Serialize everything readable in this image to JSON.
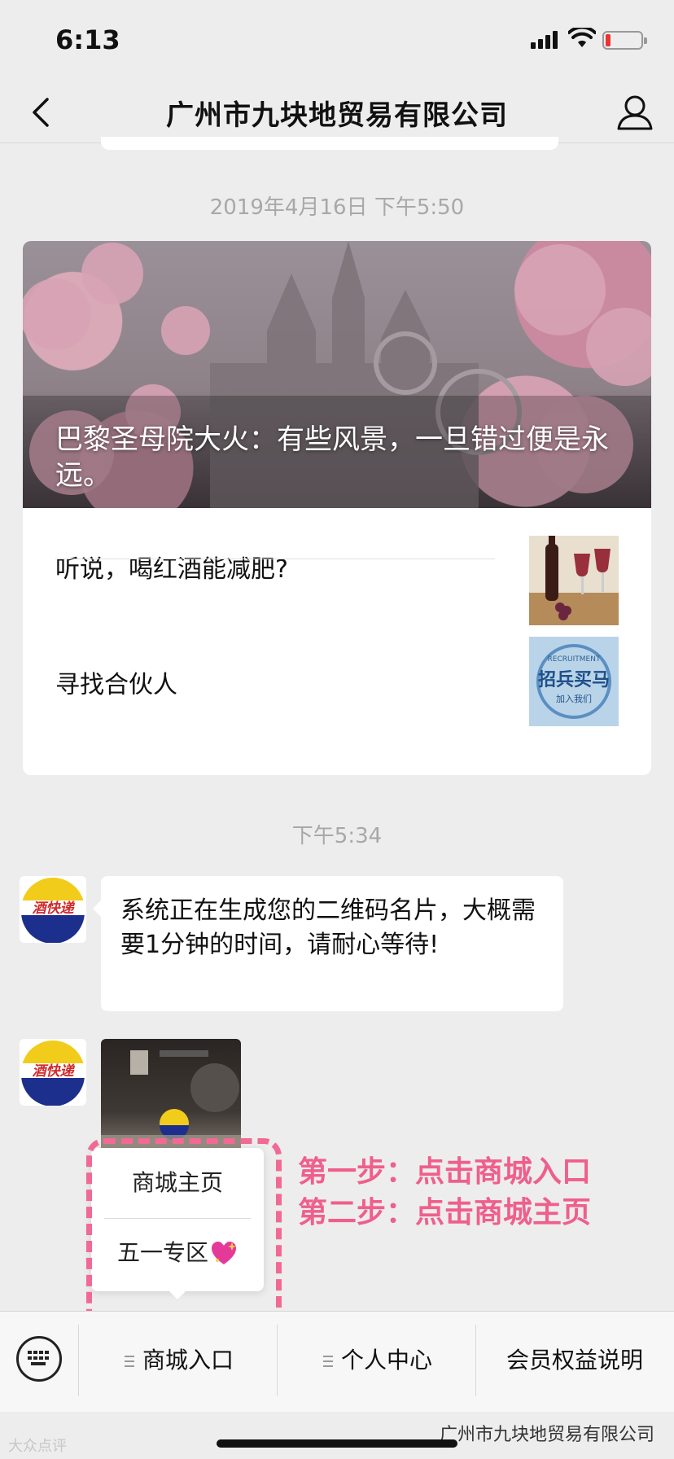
{
  "status_bar": {
    "time": "6:13",
    "battery_level": 0.15
  },
  "nav": {
    "title": "广州市九块地贸易有限公司",
    "back_icon": "chevron-left-icon",
    "profile_icon": "person-icon"
  },
  "timestamps": {
    "article": "2019年4月16日 下午5:50",
    "messages": "下午5:34"
  },
  "article": {
    "cover_title": "巴黎圣母院大火：有些风景，一旦错过便是永远。",
    "items": [
      {
        "title": "听说，喝红酒能减肥?"
      },
      {
        "title": "寻找合伙人"
      }
    ]
  },
  "thumb_text": {
    "recruitment_en": "RECRUITMENT",
    "recruitment_cn": "招兵买马",
    "join_us": "加入我们"
  },
  "messages": {
    "avatar_text": "酒快递",
    "text_message": "系统正在生成您的二维码名片，大概需要1分钟的时间，请耐心等待!"
  },
  "popup": {
    "items": [
      "商城主页",
      "五一专区"
    ],
    "emoji": "sparkling-heart-icon"
  },
  "annotations": {
    "step1": "第一步：点击商城入口",
    "step2": "第二步：点击商城主页"
  },
  "bottom_menu": {
    "keyboard_icon": "keyboard-icon",
    "items": [
      "商城入口",
      "个人中心",
      "会员权益说明"
    ]
  },
  "watermarks": {
    "left": "大众点评",
    "right": "广州市九块地贸易有限公司"
  },
  "colors": {
    "annotation": "#ef5f8c",
    "background": "#ededed",
    "avatar_red": "#d12a2a",
    "avatar_blue": "#1c2f8c",
    "avatar_yellow": "#f2cc1a"
  }
}
